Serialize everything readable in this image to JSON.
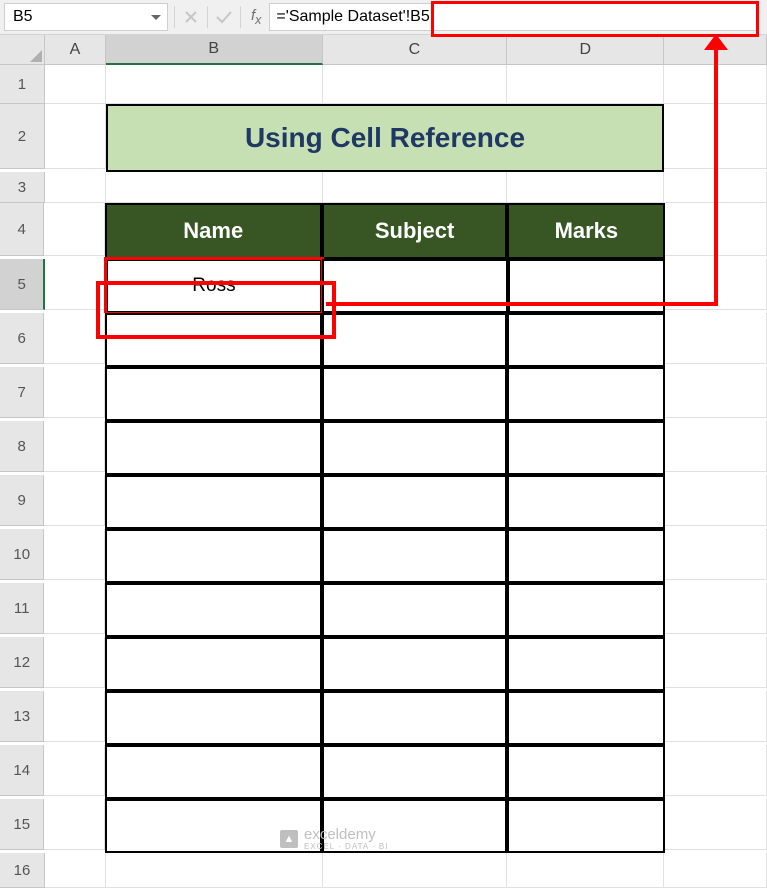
{
  "nameBox": "B5",
  "formula": "='Sample Dataset'!B5",
  "col_headers": {
    "A": "A",
    "B": "B",
    "C": "C",
    "D": "D"
  },
  "row_headers": [
    "1",
    "2",
    "3",
    "4",
    "5",
    "6",
    "7",
    "8",
    "9",
    "10",
    "11",
    "12",
    "13",
    "14",
    "15",
    "16"
  ],
  "title": "Using Cell Reference",
  "table_headers": {
    "name": "Name",
    "subject": "Subject",
    "marks": "Marks"
  },
  "table_rows": [
    {
      "name": "Ross",
      "subject": "",
      "marks": ""
    },
    {
      "name": "",
      "subject": "",
      "marks": ""
    },
    {
      "name": "",
      "subject": "",
      "marks": ""
    },
    {
      "name": "",
      "subject": "",
      "marks": ""
    },
    {
      "name": "",
      "subject": "",
      "marks": ""
    },
    {
      "name": "",
      "subject": "",
      "marks": ""
    },
    {
      "name": "",
      "subject": "",
      "marks": ""
    },
    {
      "name": "",
      "subject": "",
      "marks": ""
    },
    {
      "name": "",
      "subject": "",
      "marks": ""
    },
    {
      "name": "",
      "subject": "",
      "marks": ""
    },
    {
      "name": "",
      "subject": "",
      "marks": ""
    }
  ],
  "watermark": {
    "brand": "exceldemy",
    "sub": "EXCEL · DATA · BI"
  }
}
